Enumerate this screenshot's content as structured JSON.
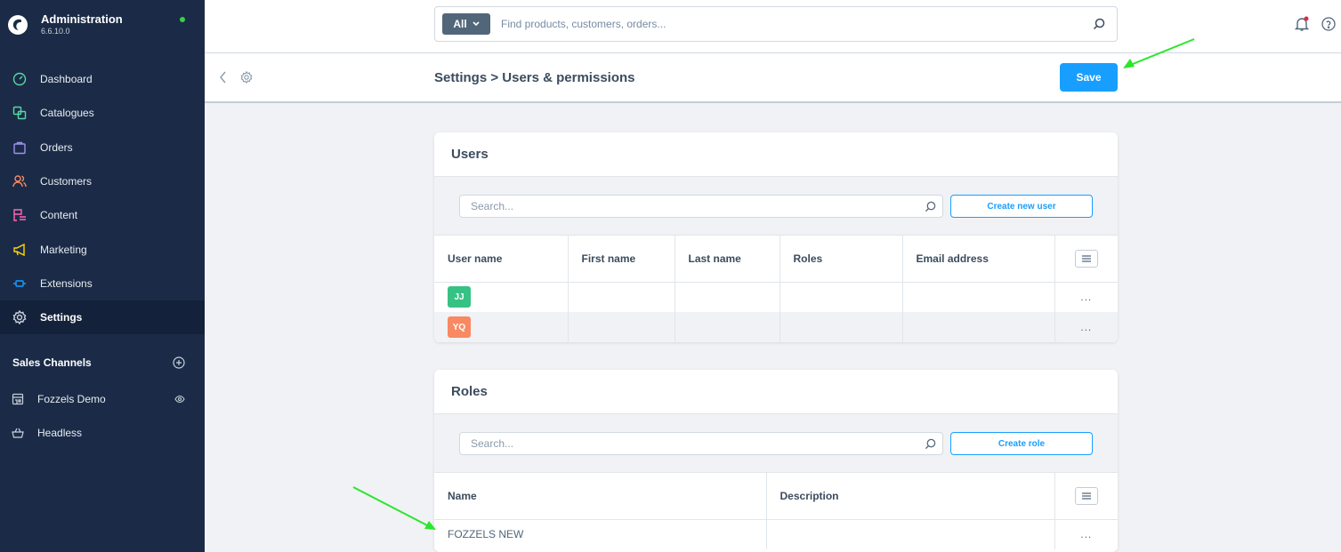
{
  "sidebar": {
    "app_title": "Administration",
    "version": "6.6.10.0",
    "colors": {
      "background": "#1b2b47",
      "online": "#37d046"
    },
    "nav": [
      {
        "label": "Dashboard",
        "icon": "dashboard-icon",
        "color": "#57d9a3"
      },
      {
        "label": "Catalogues",
        "icon": "catalogue-icon",
        "color": "#57d9a3"
      },
      {
        "label": "Orders",
        "icon": "orders-icon",
        "color": "#a092f0"
      },
      {
        "label": "Customers",
        "icon": "customers-icon",
        "color": "#f88962"
      },
      {
        "label": "Content",
        "icon": "content-icon",
        "color": "#ff68b4"
      },
      {
        "label": "Marketing",
        "icon": "marketing-icon",
        "color": "#ffd700"
      },
      {
        "label": "Extensions",
        "icon": "extensions-icon",
        "color": "#189eff"
      },
      {
        "label": "Settings",
        "icon": "settings-icon",
        "color": "#c9d1db"
      }
    ],
    "sales_channels": {
      "heading": "Sales Channels",
      "items": [
        {
          "label": "Fozzels Demo",
          "icon": "storefront-icon"
        },
        {
          "label": "Headless",
          "icon": "basket-icon"
        }
      ]
    }
  },
  "topbar": {
    "search_type": "All",
    "search_placeholder": "Find products, customers, orders..."
  },
  "smartbar": {
    "title": "Settings > Users & permissions",
    "save_label": "Save"
  },
  "users_card": {
    "title": "Users",
    "search_placeholder": "Search...",
    "create_label": "Create new user",
    "columns": [
      "User name",
      "First name",
      "Last name",
      "Roles",
      "Email address"
    ],
    "rows": [
      {
        "initials": "JJ",
        "avatar_color": "#37c285",
        "row_action": "..."
      },
      {
        "initials": "YQ",
        "avatar_color": "#f88962",
        "row_action": "..."
      }
    ]
  },
  "roles_card": {
    "title": "Roles",
    "search_placeholder": "Search...",
    "create_label": "Create role",
    "columns": [
      "Name",
      "Description"
    ],
    "rows": [
      {
        "name": "FOZZELS NEW",
        "description": "",
        "row_action": "..."
      }
    ]
  },
  "accent": "#189eff"
}
